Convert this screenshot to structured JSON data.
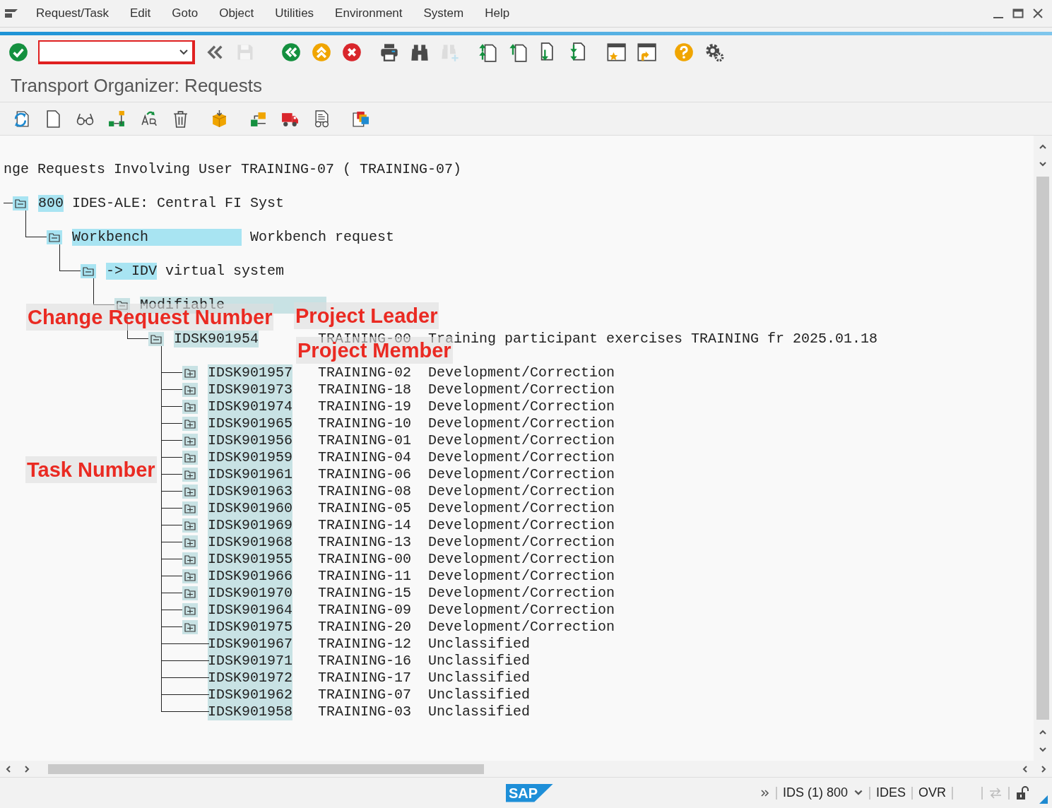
{
  "menu": [
    "Request/Task",
    "Edit",
    "Goto",
    "Object",
    "Utilities",
    "Environment",
    "System",
    "Help"
  ],
  "toolbar": [
    {
      "kind": "enter",
      "disabled": false
    },
    {
      "kind": "command-field",
      "disabled": false
    },
    {
      "kind": "more",
      "disabled": false
    },
    {
      "kind": "save",
      "disabled": true
    },
    {
      "kind": "back",
      "disabled": false
    },
    {
      "kind": "exit",
      "disabled": false
    },
    {
      "kind": "cancel",
      "disabled": false
    },
    {
      "kind": "print",
      "disabled": false
    },
    {
      "kind": "find",
      "disabled": false
    },
    {
      "kind": "find-next",
      "disabled": true
    },
    {
      "kind": "first-page",
      "disabled": false
    },
    {
      "kind": "prev-page",
      "disabled": false
    },
    {
      "kind": "next-page",
      "disabled": false
    },
    {
      "kind": "last-page",
      "disabled": false
    },
    {
      "kind": "new-session",
      "disabled": false
    },
    {
      "kind": "shortcut",
      "disabled": false
    },
    {
      "kind": "help",
      "disabled": false
    },
    {
      "kind": "settings",
      "disabled": false
    }
  ],
  "screen_title": "Transport Organizer: Requests",
  "app_toolbar": [
    {
      "kind": "refresh"
    },
    {
      "kind": "create"
    },
    {
      "kind": "display"
    },
    {
      "kind": "hierarchy"
    },
    {
      "kind": "change-owner"
    },
    {
      "kind": "delete"
    },
    {
      "kind": "release"
    },
    {
      "kind": "check"
    },
    {
      "kind": "transport"
    },
    {
      "kind": "display-doc"
    },
    {
      "kind": "copy"
    }
  ],
  "header": "nge Requests Involving User TRAINING-07 ( TRAINING-07)",
  "tree": [
    {
      "kind": "folder",
      "key": "800",
      "text": "IDES-ALE: Central FI Syst",
      "children": [
        {
          "kind": "folder",
          "key": "Workbench",
          "text": "Workbench request",
          "children": [
            {
              "kind": "folder",
              "key": "-> IDV",
              "text": "virtual system",
              "children": [
                {
                  "kind": "folder",
                  "key": "Modifiable",
                  "children": [
                    {
                      "kind": "folder",
                      "key": "IDSK901954",
                      "owner": "TRAINING-00",
                      "text": "Training participant exercises TRAINING fr 2025.01.18",
                      "children": [
                        {
                          "kind": "task",
                          "key": "IDSK901957",
                          "owner": "TRAINING-02",
                          "text": "Development/Correction"
                        },
                        {
                          "kind": "task",
                          "key": "IDSK901973",
                          "owner": "TRAINING-18",
                          "text": "Development/Correction"
                        },
                        {
                          "kind": "task",
                          "key": "IDSK901974",
                          "owner": "TRAINING-19",
                          "text": "Development/Correction"
                        },
                        {
                          "kind": "task",
                          "key": "IDSK901965",
                          "owner": "TRAINING-10",
                          "text": "Development/Correction"
                        },
                        {
                          "kind": "task",
                          "key": "IDSK901956",
                          "owner": "TRAINING-01",
                          "text": "Development/Correction"
                        },
                        {
                          "kind": "task",
                          "key": "IDSK901959",
                          "owner": "TRAINING-04",
                          "text": "Development/Correction"
                        },
                        {
                          "kind": "task",
                          "key": "IDSK901961",
                          "owner": "TRAINING-06",
                          "text": "Development/Correction"
                        },
                        {
                          "kind": "task",
                          "key": "IDSK901963",
                          "owner": "TRAINING-08",
                          "text": "Development/Correction"
                        },
                        {
                          "kind": "task",
                          "key": "IDSK901960",
                          "owner": "TRAINING-05",
                          "text": "Development/Correction"
                        },
                        {
                          "kind": "task",
                          "key": "IDSK901969",
                          "owner": "TRAINING-14",
                          "text": "Development/Correction"
                        },
                        {
                          "kind": "task",
                          "key": "IDSK901968",
                          "owner": "TRAINING-13",
                          "text": "Development/Correction"
                        },
                        {
                          "kind": "task",
                          "key": "IDSK901955",
                          "owner": "TRAINING-00",
                          "text": "Development/Correction"
                        },
                        {
                          "kind": "task",
                          "key": "IDSK901966",
                          "owner": "TRAINING-11",
                          "text": "Development/Correction"
                        },
                        {
                          "kind": "task",
                          "key": "IDSK901970",
                          "owner": "TRAINING-15",
                          "text": "Development/Correction"
                        },
                        {
                          "kind": "task",
                          "key": "IDSK901964",
                          "owner": "TRAINING-09",
                          "text": "Development/Correction"
                        },
                        {
                          "kind": "task",
                          "key": "IDSK901975",
                          "owner": "TRAINING-20",
                          "text": "Development/Correction"
                        },
                        {
                          "kind": "leaf",
                          "key": "IDSK901967",
                          "owner": "TRAINING-12",
                          "text": "Unclassified"
                        },
                        {
                          "kind": "leaf",
                          "key": "IDSK901971",
                          "owner": "TRAINING-16",
                          "text": "Unclassified"
                        },
                        {
                          "kind": "leaf",
                          "key": "IDSK901972",
                          "owner": "TRAINING-17",
                          "text": "Unclassified"
                        },
                        {
                          "kind": "leaf",
                          "key": "IDSK901962",
                          "owner": "TRAINING-07",
                          "text": "Unclassified"
                        },
                        {
                          "kind": "leaf",
                          "key": "IDSK901958",
                          "owner": "TRAINING-03",
                          "text": "Unclassified"
                        }
                      ]
                    }
                  ]
                }
              ]
            }
          ]
        }
      ]
    }
  ],
  "annotations": [
    "Change Request Number",
    "Project Leader",
    "Project Member",
    "Task Number"
  ],
  "status_bar": {
    "logo": "SAP",
    "system": "IDS (1) 800",
    "client_host": "IDES",
    "mode": "OVR"
  }
}
